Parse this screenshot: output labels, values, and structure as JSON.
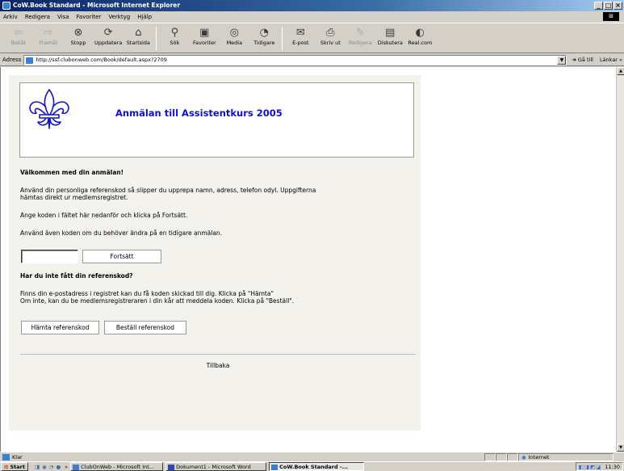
{
  "window": {
    "title": "CoW.Book Standard - Microsoft Internet Explorer",
    "buttons": [
      "_",
      "□",
      "×"
    ]
  },
  "menu": [
    "Arkiv",
    "Redigera",
    "Visa",
    "Favoriter",
    "Verktyg",
    "Hjälp"
  ],
  "toolbar": {
    "back": "Bakåt",
    "forward": "Framåt",
    "stop": "Stopp",
    "refresh": "Uppdatera",
    "home": "Startsida",
    "search": "Sök",
    "favorites": "Favoriter",
    "media": "Media",
    "history": "Tidigare",
    "mail": "E-post",
    "print": "Skriv ut",
    "edit": "Redigera",
    "discuss": "Diskutera",
    "realcom": "Real.com"
  },
  "address": {
    "label": "Adress",
    "url": "http://ssf.clubonweb.com/Book/default.aspx?2709",
    "go": "Gå till",
    "links": "Länkar »"
  },
  "page": {
    "title": "Anmälan till  Assistentkurs 2005",
    "welcome_heading": "Välkommen med din anmälan!",
    "intro_line1": "Använd din personliga referenskod så slipper du upprepa namn, adress, telefon odyl. Uppgifterna",
    "intro_line2": "hämtas direkt ur medlemsregistret.",
    "instruction": "Ange koden i fältet här nedanför och klicka på Fortsätt.",
    "change_note": "Använd även koden om du behöver ändra på en tidigare anmälan.",
    "ref_input_value": "",
    "continue_button": "Fortsätt",
    "no_code_heading": "Har du inte fått din referenskod?",
    "no_code_line1": "Finns din e-postadress i registret kan du få koden skickad till dig. Klicka på \"Hämta\"",
    "no_code_line2": "Om inte, kan du be medlemsregistreraren i din kår att meddela koden. Klicka på \"Beställ\".",
    "fetch_button": "Hämta referenskod",
    "order_button": "Beställ referenskod",
    "back_link": "Tillbaka"
  },
  "status": {
    "text": "Klar",
    "zone": "Internet"
  },
  "taskbar": {
    "start": "Start",
    "quicklaunch_more": "»",
    "tasks": [
      "ClubOnWeb - Microsoft Int...",
      "Dokument1 - Microsoft Word",
      "CoW.Book Standard -..."
    ],
    "clock": "11:30"
  },
  "colors": {
    "title_blue": "#1010d8",
    "titlebar": "#0a246a",
    "chrome": "#d4d0c8",
    "page_bg": "#f3f2ed"
  }
}
